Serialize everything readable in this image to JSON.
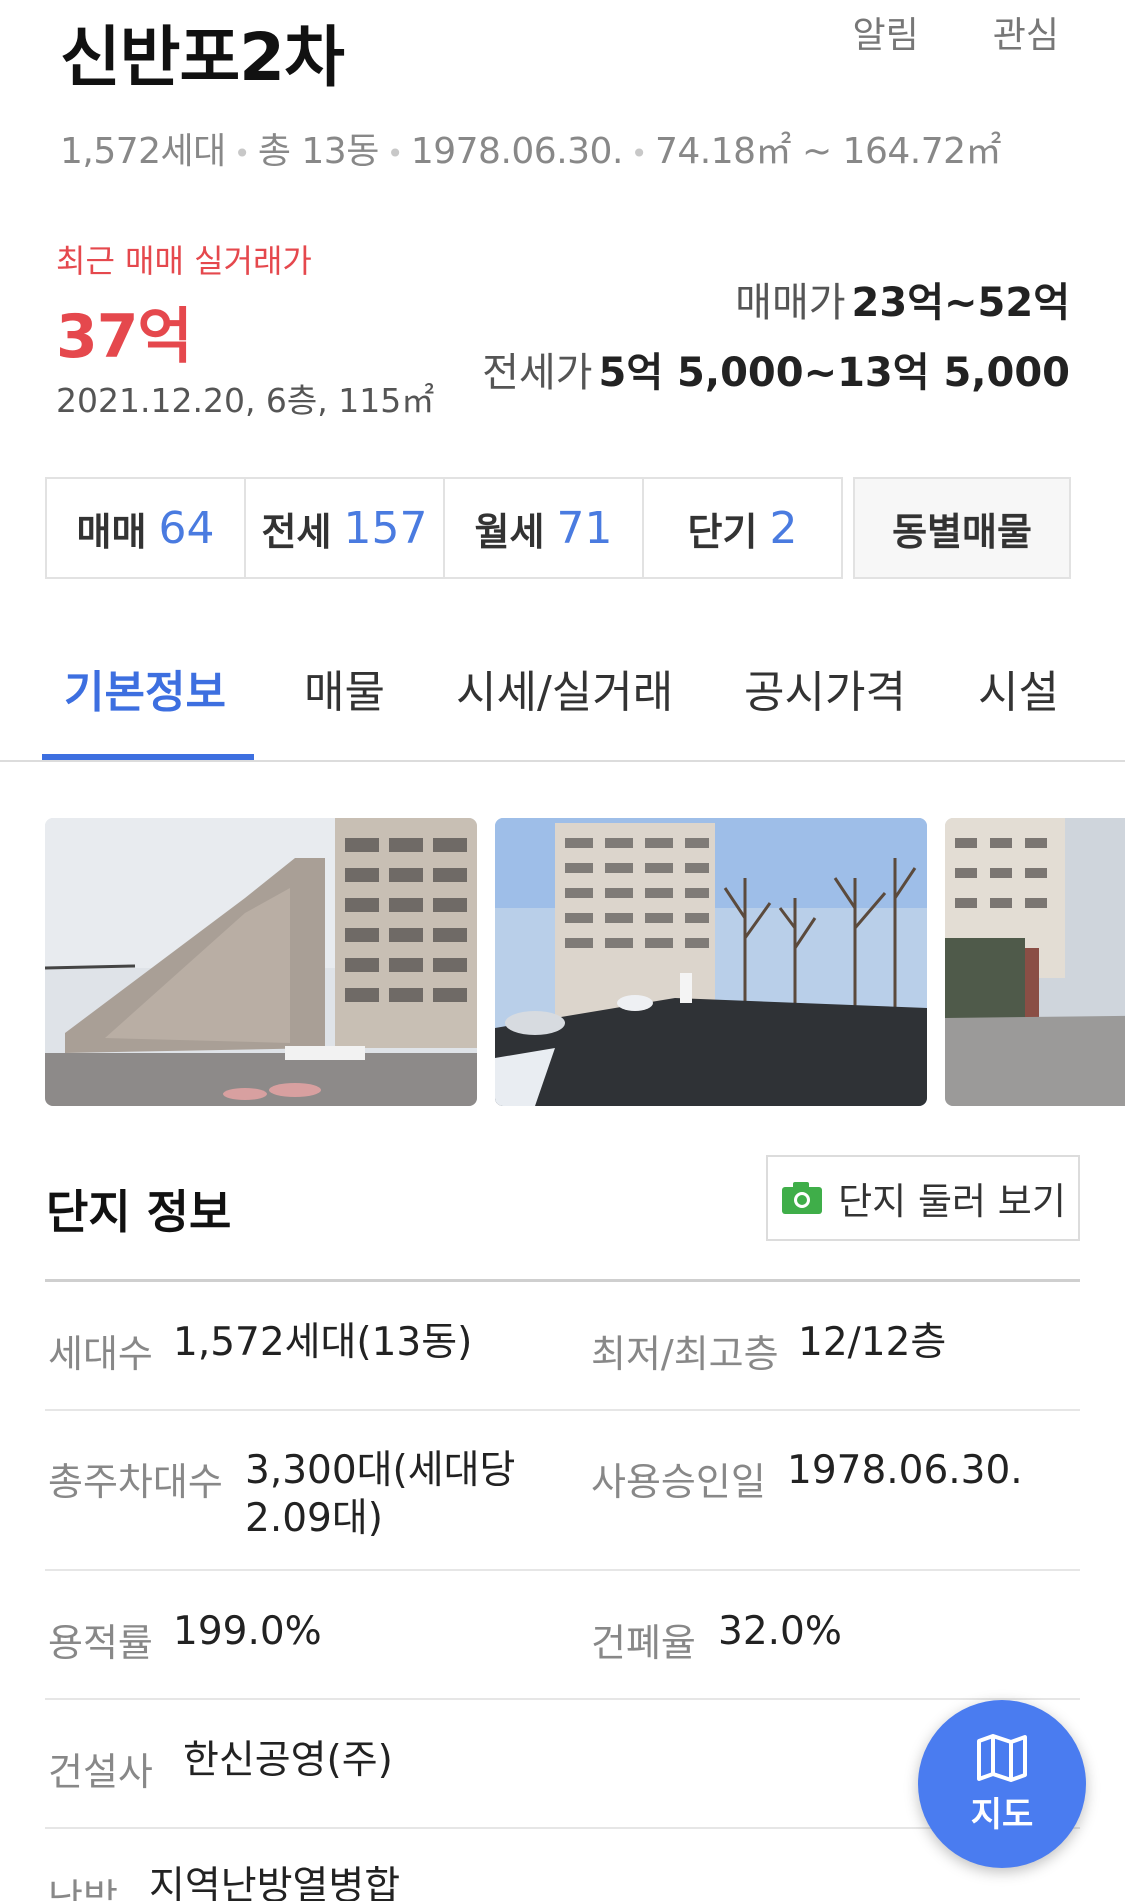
{
  "header": {
    "title": "신반포2차",
    "actions": {
      "alert": "알림",
      "favorite": "관심"
    },
    "summary": {
      "households": "1,572세대",
      "buildings": "총 13동",
      "approval_date": "1978.06.30.",
      "area_range": "74.18㎡ ~ 164.72㎡"
    }
  },
  "prices": {
    "recent_label": "최근 매매 실거래가",
    "recent_price": "37억",
    "recent_detail": "2021.12.20, 6층, 115㎡",
    "sale_label": "매매가",
    "sale_range": "23억~52억",
    "jeonse_label": "전세가",
    "jeonse_range": "5억 5,000~13억 5,000"
  },
  "listing_tabs": [
    {
      "label": "매매",
      "count": "64"
    },
    {
      "label": "전세",
      "count": "157"
    },
    {
      "label": "월세",
      "count": "71"
    },
    {
      "label": "단기",
      "count": "2"
    }
  ],
  "building_listings_label": "동별매물",
  "nav_tabs": [
    "기본정보",
    "매물",
    "시세/실거래",
    "공시가격",
    "시설"
  ],
  "complex_info": {
    "title": "단지 정보",
    "tour_button": "단지 둘러 보기",
    "rows": [
      {
        "l1": "세대수",
        "v1": "1,572세대(13동)",
        "l2": "최저/최고층",
        "v2": "12/12층"
      },
      {
        "l1": "총주차대수",
        "v1": "3,300대(세대당 2.09대)",
        "l2": "사용승인일",
        "v2": "1978.06.30."
      },
      {
        "l1": "용적률",
        "v1": "199.0%",
        "l2": "건폐율",
        "v2": "32.0%"
      },
      {
        "l1": "건설사",
        "v1": "한신공영(주)"
      },
      {
        "l1": "난방",
        "v1": "지역난방열병합"
      }
    ]
  },
  "map_button": {
    "label": "지도",
    "icon": "map-icon"
  },
  "colors": {
    "accent_blue": "#3d6fe0",
    "price_red": "#e5484d",
    "fab_blue": "#4a7cf0"
  }
}
